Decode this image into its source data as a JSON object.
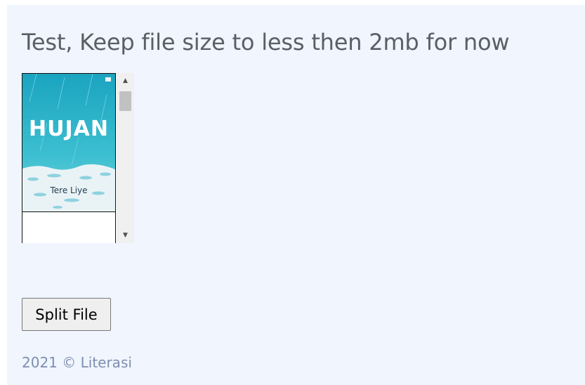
{
  "header": {
    "title": "Test, Keep file size to less then 2mb for now"
  },
  "preview": {
    "cover_title": "HUJAN",
    "cover_author": "Tere Liye",
    "cover_color": "#2ab0c8"
  },
  "actions": {
    "split_label": "Split File"
  },
  "footer": {
    "text": "2021 © Literasi"
  },
  "icons": {
    "scroll_up": "triangle-up",
    "scroll_down": "triangle-down"
  }
}
